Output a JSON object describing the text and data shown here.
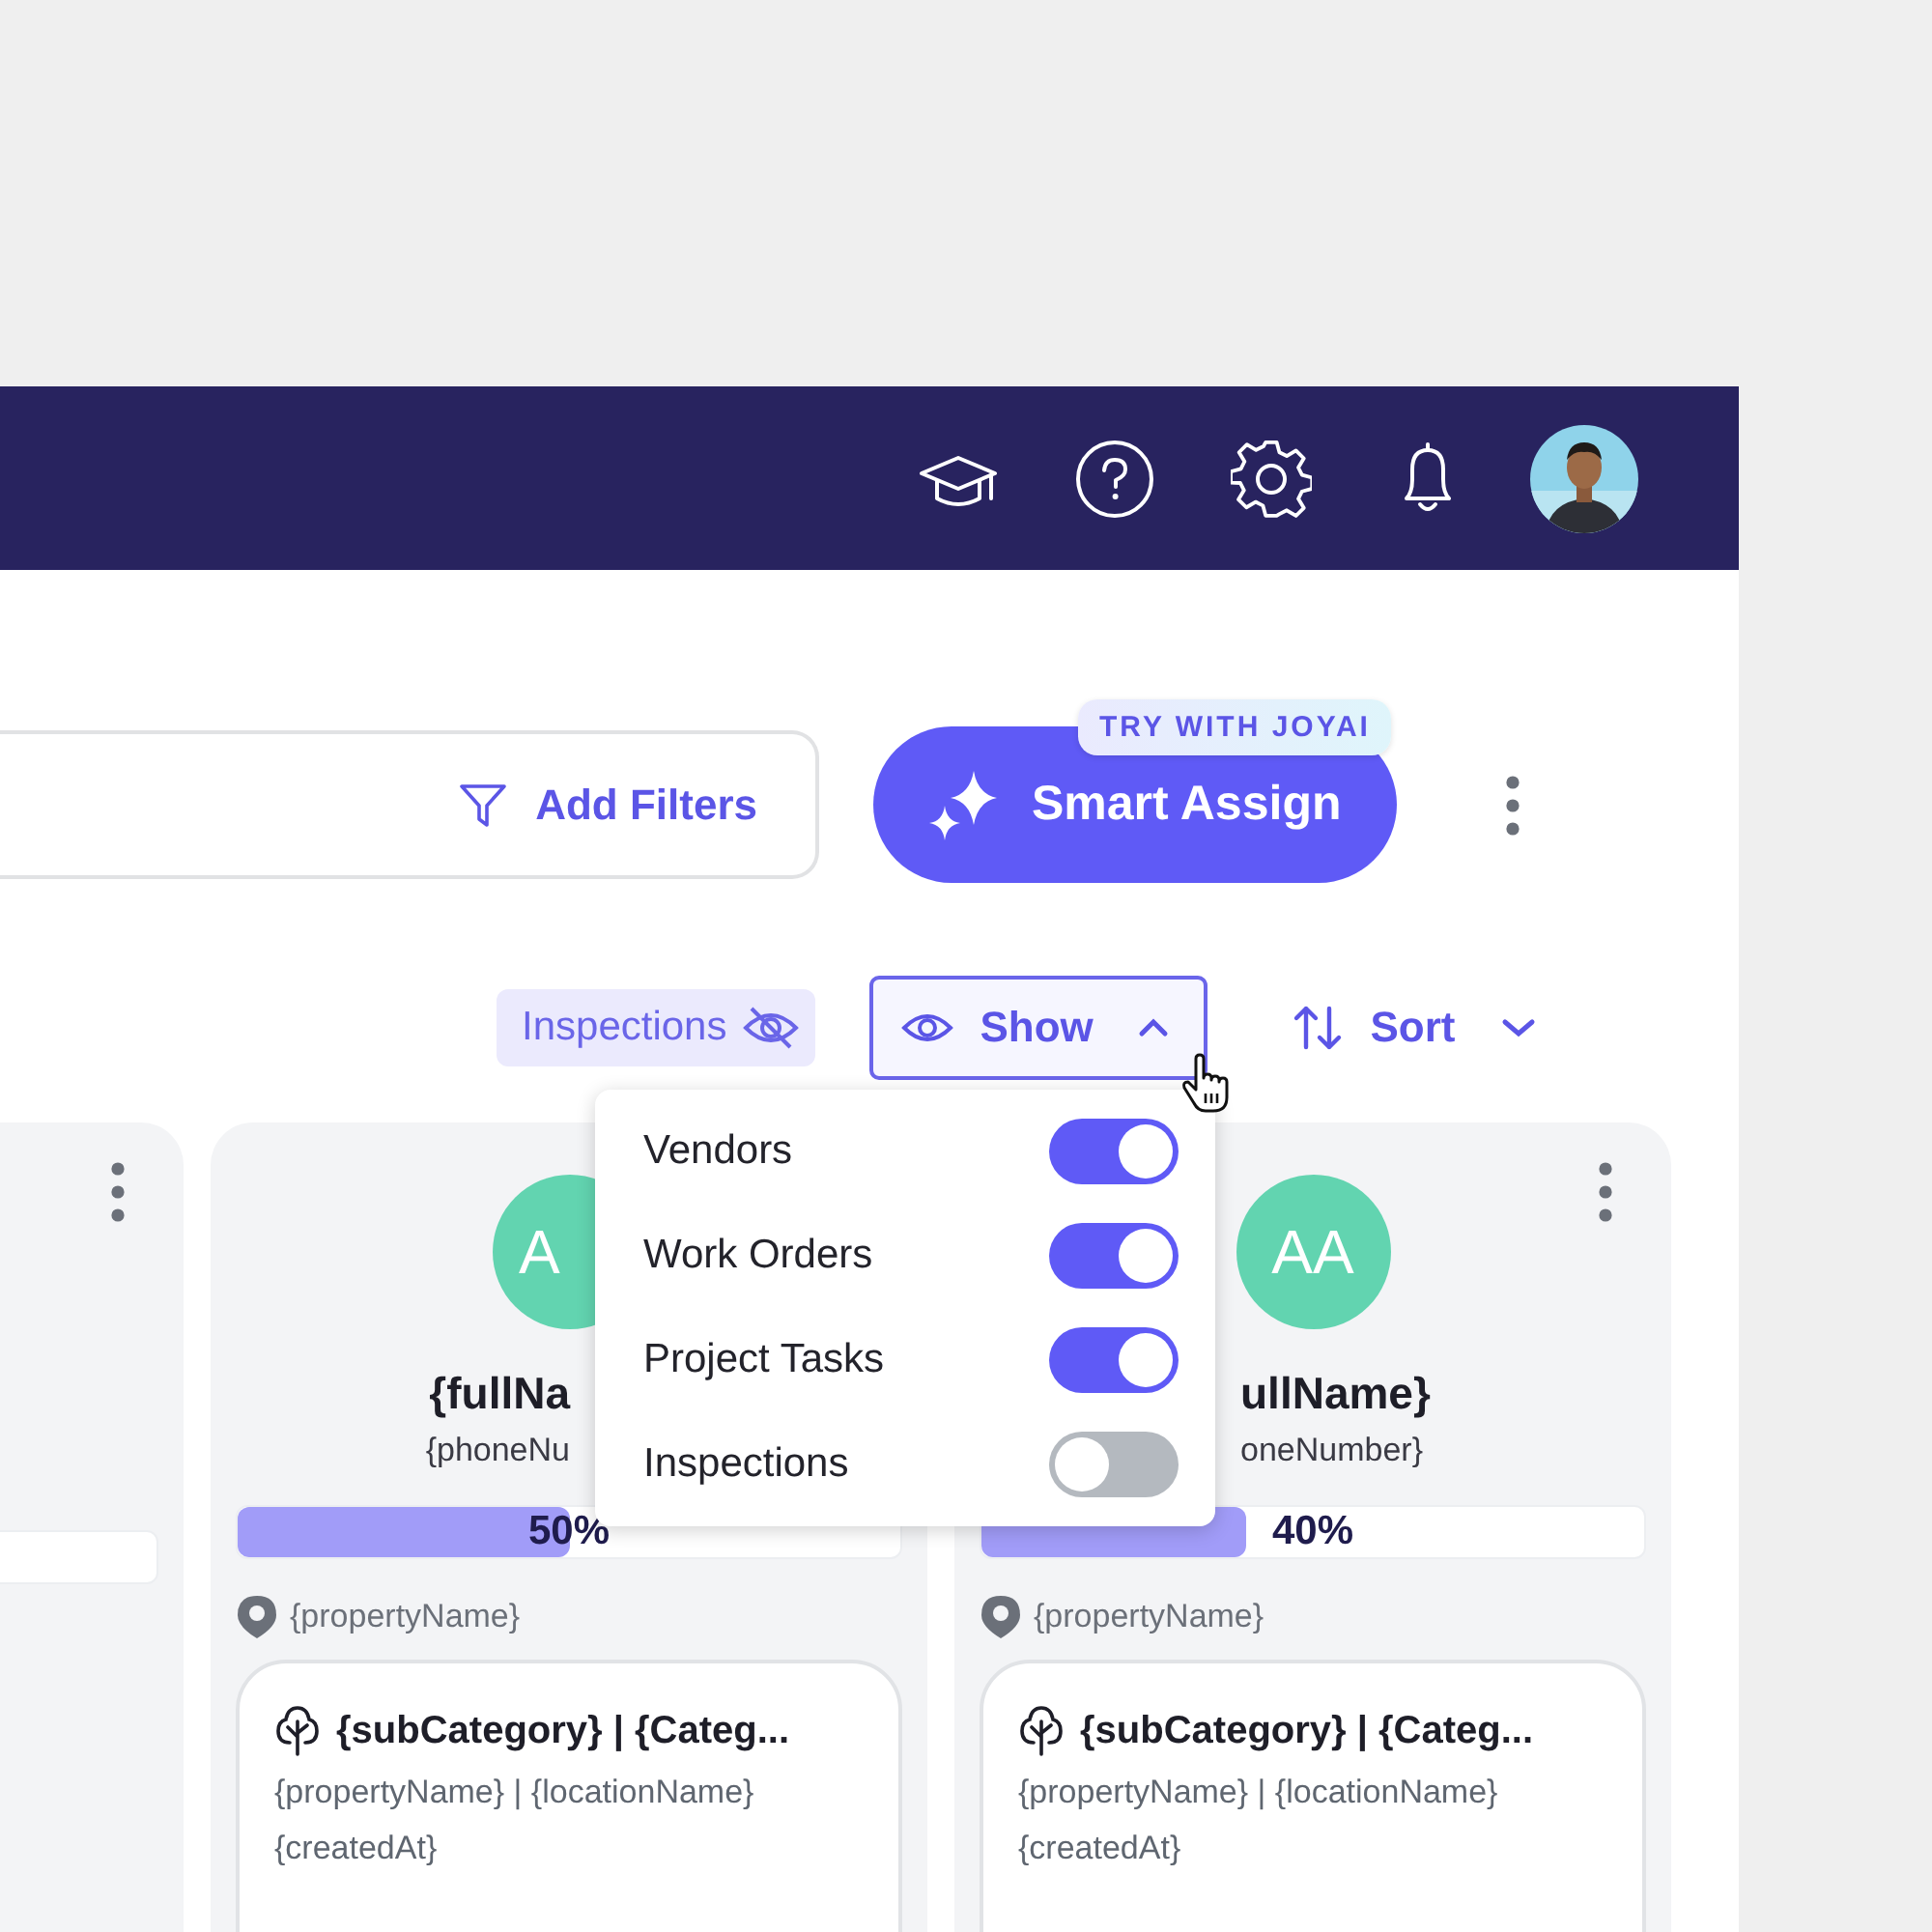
{
  "toolbar": {
    "filter_button": "Add Filters",
    "smart_assign": {
      "label": "Smart Assign",
      "badge": "TRY WITH JOYAI"
    }
  },
  "view_controls": {
    "hidden_chip": "Inspections",
    "show_button": {
      "label": "Show",
      "expanded": true
    },
    "sort_button": "Sort"
  },
  "show_menu": {
    "items": [
      {
        "label": "Vendors",
        "on": true
      },
      {
        "label": "Work Orders",
        "on": true
      },
      {
        "label": "Project Tasks",
        "on": true
      },
      {
        "label": "Inspections",
        "on": false
      }
    ]
  },
  "cards": [
    {
      "initials": "A",
      "name": "{fullNa",
      "phone": "{phoneNu",
      "level": 0.5,
      "progress_label": "50%",
      "property": "{propertyName}",
      "item": {
        "title": "{subCategory} | {Categ...",
        "subtitle": "{propertyName} | {locationName}",
        "date": "{createdAt}"
      }
    },
    {
      "initials": "AA",
      "name": "ullName}",
      "phone": "oneNumber}",
      "level": 0.4,
      "progress_label": "40%",
      "property": "{propertyName}",
      "item": {
        "title": "{subCategory} | {Categ...",
        "subtitle": "{propertyName} | {locationName}",
        "date": "{createdAt}"
      }
    }
  ]
}
